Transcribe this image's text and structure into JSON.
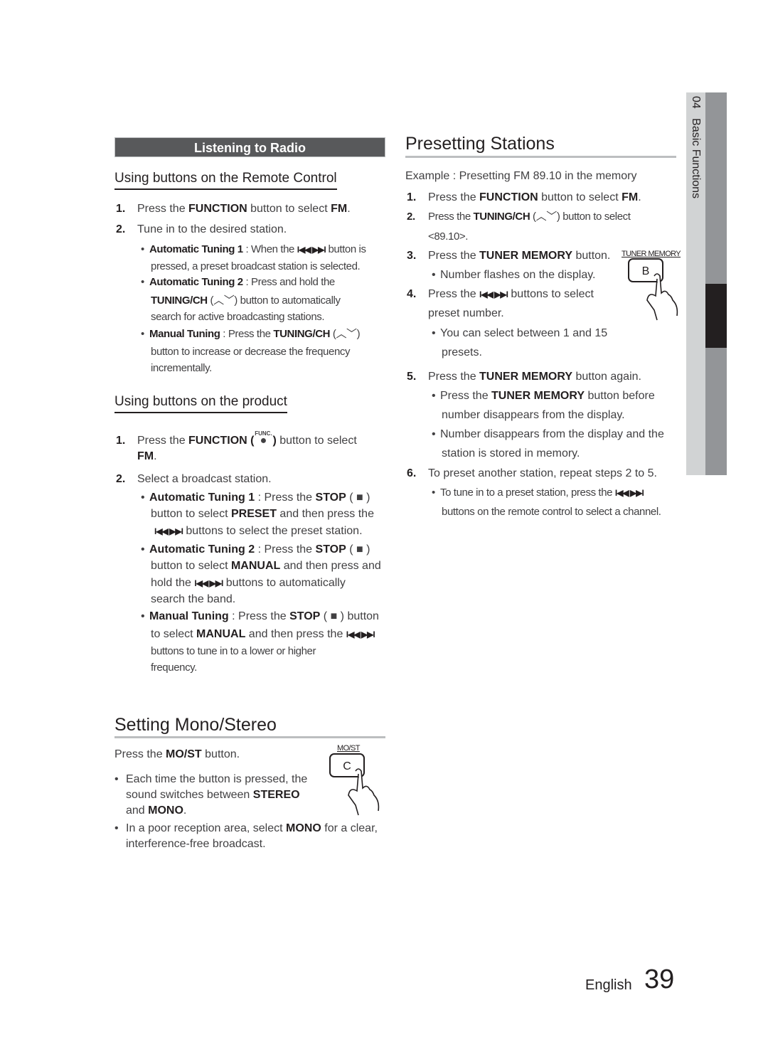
{
  "side_tab": {
    "chapter": "04",
    "title": "Basic Functions"
  },
  "left": {
    "section_bar": "Listening to Radio",
    "remote": {
      "heading": "Using buttons on the Remote Control",
      "step1": {
        "n": "1.",
        "a": "Press the ",
        "b1": "FUNCTION",
        "c": " button to select ",
        "b2": "FM",
        "d": "."
      },
      "step2": {
        "n": "2.",
        "text": "Tune in to the desired station."
      },
      "bullets": [
        {
          "label": "Automatic Tuning 1",
          "l1": " : When the ",
          "skip": "I◀◀ ▶▶I",
          "l1b": " button is",
          "l2": "pressed, a preset broadcast station is selected."
        },
        {
          "label": "Automatic Tuning 2",
          "l1": " : Press and hold the",
          "b": "TUNING/CH",
          "l2": " (︿﹀) button to automatically",
          "l3": "search for active broadcasting stations."
        },
        {
          "label": "Manual Tuning",
          "l1": " : Press the ",
          "b": "TUNING/CH",
          "l1b": " (︿﹀)",
          "l2": "button to increase or decrease the frequency",
          "l3": "incrementally."
        }
      ]
    },
    "product": {
      "heading": "Using buttons on the product",
      "step1": {
        "n": "1.",
        "a": "Press the ",
        "b1": "FUNCTION",
        "func_label": "FUNC.",
        "c": " button to select",
        "b2": "FM",
        "d": "."
      },
      "step2": {
        "n": "2.",
        "text": "Select a broadcast station."
      },
      "bullets": [
        {
          "label": "Automatic Tuning 1",
          "l1": " : Press the ",
          "b": "STOP",
          "stop": " ( ■ )",
          "l2a": "button to select ",
          "b2": "PRESET",
          "l2b": " and then press the",
          "skip": "I◀◀ ▶▶I",
          "l3": " buttons to select the preset station."
        },
        {
          "label": "Automatic Tuning 2",
          "l1": " : Press the ",
          "b": "STOP",
          "stop": " ( ■ )",
          "l2a": "button to select ",
          "b2": "MANUAL",
          "l2b": " and then press and",
          "l3a": "hold the ",
          "skip": "I◀◀ ▶▶I",
          "l3b": " buttons to automatically",
          "l4": "search the band."
        },
        {
          "label": "Manual Tuning",
          "l1": " : Press the ",
          "b": "STOP",
          "stop": " ( ■ ) button",
          "l2a": "to select ",
          "b2": "MANUAL",
          "l2b": " and then press the ",
          "skip": "I◀◀ ▶▶I",
          "l3": "buttons to tune in to a lower or higher",
          "l4": "frequency."
        }
      ]
    },
    "mono": {
      "heading": "Setting Mono/Stereo",
      "intro_a": "Press the ",
      "intro_b": "MO/ST",
      "intro_c": " button.",
      "button_label": "MO/ST",
      "button_key": "C",
      "bullet1": {
        "l1": "Each time the button is pressed, the",
        "l2a": "sound switches between ",
        "b1": "STEREO",
        "l3a": "and ",
        "b2": "MONO",
        "l3b": "."
      },
      "bullet2": {
        "l1a": "In a poor reception area, select ",
        "b": "MONO",
        "l1b": " for a clear,",
        "l2": "interference-free broadcast."
      }
    }
  },
  "right": {
    "heading": "Presetting Stations",
    "example": "Example : Presetting FM 89.10 in the memory",
    "steps": [
      {
        "n": "1.",
        "a": "Press the ",
        "b1": "FUNCTION",
        "c": " button to select ",
        "b2": "FM",
        "d": "."
      },
      {
        "n": "2.",
        "a": "Press the ",
        "b1": "TUNING/CH",
        "c": " (︿﹀) button to select",
        "l2": "<89.10>."
      },
      {
        "n": "3.",
        "a": "Press the ",
        "b1": "TUNER MEMORY",
        "c": " button.",
        "sub": "Number flashes on the display."
      },
      {
        "n": "4.",
        "a": "Press the ",
        "skip": "I◀◀ ▶▶I",
        "c": " buttons to select",
        "l2": "preset number.",
        "sub1": "You can select between 1 and 15",
        "sub2": "presets."
      },
      {
        "n": "5.",
        "a": "Press the ",
        "b1": "TUNER MEMORY",
        "c": " button again.",
        "subs": [
          {
            "a": "Press the ",
            "b": "TUNER MEMORY",
            "c": " button before",
            "l2": "number disappears from the display."
          },
          {
            "l1": "Number disappears from the display and the",
            "l2": "station is stored in memory."
          }
        ]
      },
      {
        "n": "6.",
        "text": "To preset another station, repeat steps 2 to 5.",
        "sub_l1a": "To tune in to a preset station, press the ",
        "skip": "I◀◀ ▶▶I",
        "sub_l2": "buttons on the remote control to select a channel."
      }
    ],
    "button_label": "TUNER MEMORY",
    "button_key": "B"
  },
  "footer": {
    "language": "English",
    "page": "39"
  }
}
